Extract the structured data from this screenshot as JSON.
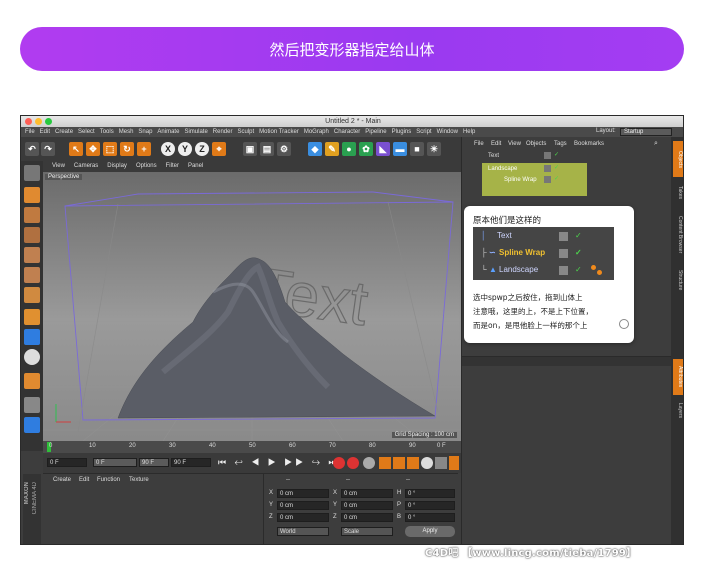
{
  "banner": {
    "text": "然后把变形器指定给山体"
  },
  "window": {
    "title": "Untitled 2 * - Main"
  },
  "menus": [
    "File",
    "Edit",
    "Create",
    "Select",
    "Tools",
    "Mesh",
    "Snap",
    "Animate",
    "Simulate",
    "Render",
    "Sculpt",
    "Motion Tracker",
    "MoGraph",
    "Character",
    "Pipeline",
    "Plugins",
    "Script",
    "Window",
    "Help"
  ],
  "layout": {
    "label": "Layout:",
    "value": "Startup"
  },
  "toolbar": {
    "axis_x": "X",
    "axis_y": "Y",
    "axis_z": "Z"
  },
  "viewport": {
    "menus": [
      "View",
      "Cameras",
      "Display",
      "Options",
      "Filter",
      "Panel"
    ],
    "camera_label": "Perspective",
    "scene_text": "Text",
    "grid_spacing": "Grid Spacing : 100 cm"
  },
  "timeline": {
    "ticks": [
      "0",
      "10",
      "20",
      "30",
      "40",
      "50",
      "60",
      "70",
      "80",
      "90"
    ],
    "end_frame": "0 F"
  },
  "anim": {
    "start": "0 F",
    "min": "0 F",
    "max": "90 F",
    "end": "90 F"
  },
  "material": {
    "menus": [
      "Create",
      "Edit",
      "Function",
      "Texture"
    ]
  },
  "brand": {
    "line1": "MAXON",
    "line2": "CINEMA 4D"
  },
  "coords": {
    "header": [
      "--",
      "--",
      "--"
    ],
    "rows": [
      {
        "a": "X",
        "av": "0 cm",
        "b": "X",
        "bv": "0 cm",
        "c": "H",
        "cv": "0 °"
      },
      {
        "a": "Y",
        "av": "0 cm",
        "b": "Y",
        "bv": "0 cm",
        "c": "P",
        "cv": "0 °"
      },
      {
        "a": "Z",
        "av": "0 cm",
        "b": "Z",
        "bv": "0 cm",
        "c": "B",
        "cv": "0 °"
      }
    ],
    "mode": "World",
    "scale": "Scale",
    "apply": "Apply"
  },
  "objects_panel": {
    "menus": [
      "File",
      "Edit",
      "View",
      "Objects",
      "Tags",
      "Bookmarks"
    ],
    "items": [
      "Text",
      "Landscape",
      "Spline Wrap"
    ]
  },
  "side_tabs": [
    "Objects",
    "Takes",
    "Content Browser",
    "Structure"
  ],
  "attr_tabs": [
    "Attributes",
    "Layers"
  ],
  "popup": {
    "title": "原本他们是这样的",
    "rows": [
      "Text",
      "Spline Wrap",
      "Landscape"
    ],
    "lines": [
      "选中spwp之后按住，拖到山体上",
      "注意哦，这里的上，不是上下位置，",
      "而是on，是甩他脸上一样的那个上"
    ]
  },
  "watermark": "C4D吧 【www.lincg.com/tieba/1799】",
  "colors": {
    "banner": "#a63cf0",
    "accent_orange": "#f08a1c",
    "highlight_green": "#b8c84a",
    "spline_yellow": "#f0c030"
  }
}
